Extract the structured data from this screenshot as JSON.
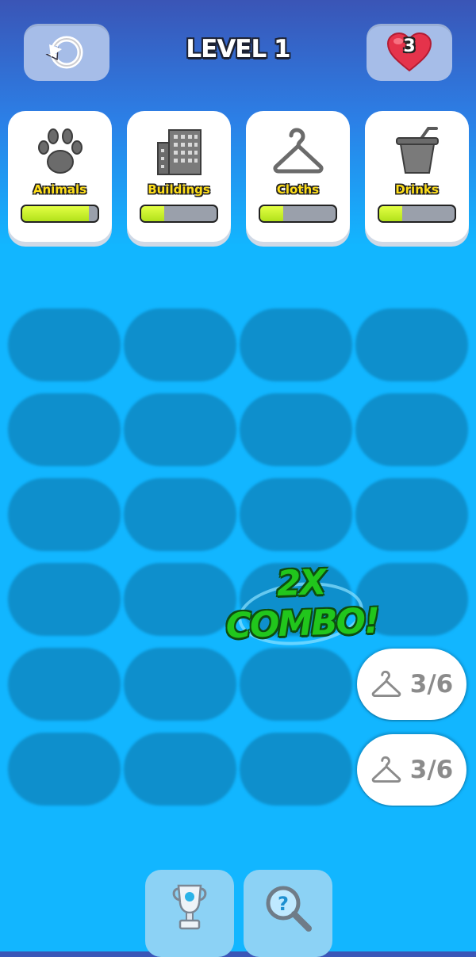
{
  "header": {
    "level_title": "LEVEL 1",
    "lives_count": "3"
  },
  "categories": [
    {
      "label": "Animals",
      "icon": "paw-icon",
      "progress": 0.88
    },
    {
      "label": "Buildings",
      "icon": "building-icon",
      "progress": 0.3
    },
    {
      "label": "Cloths",
      "icon": "hanger-icon",
      "progress": 0.3
    },
    {
      "label": "Drinks",
      "icon": "cup-icon",
      "progress": 0.3
    }
  ],
  "grid": {
    "rows": 6,
    "cols": 4
  },
  "counters": [
    {
      "icon": "hanger-icon",
      "text": "3/6"
    },
    {
      "icon": "hanger-icon",
      "text": "3/6"
    }
  ],
  "combo_text": "2X COMBO!",
  "bottom_buttons": [
    {
      "icon": "trophy-icon"
    },
    {
      "icon": "magnifier-hint-icon"
    }
  ],
  "colors": {
    "background": "#12b6ff",
    "slot": "#0e8fcc",
    "label_yellow": "#ffde1a",
    "combo_green": "#21c61c",
    "progress_fill": "#c6f02a"
  }
}
